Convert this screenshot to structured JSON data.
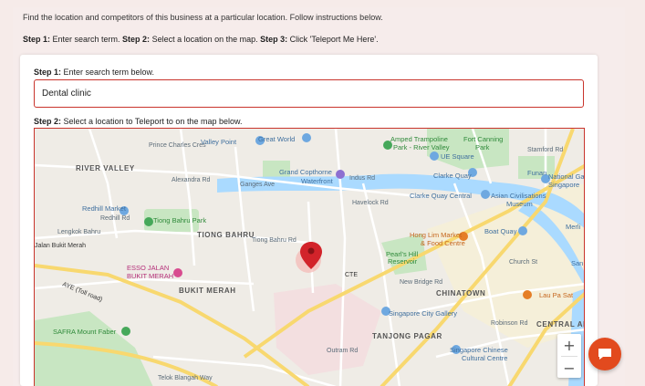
{
  "instructions": {
    "intro": "Find the location and competitors of this business at a particular location. Follow instructions below.",
    "step1_bold": "Step 1:",
    "step1_text": " Enter search term. ",
    "step2_bold": "Step 2:",
    "step2_text": " Select a location on the map. ",
    "step3_bold": "Step 3:",
    "step3_text": " Click 'Teleport Me Here'."
  },
  "form": {
    "step1_label_bold": "Step 1:",
    "step1_label_text": " Enter search term below.",
    "search_value": "Dental clinic",
    "step2_label_bold": "Step 2:",
    "step2_label_text": " Select a location to Teleport to on the map below."
  },
  "map": {
    "zoom_in": "+",
    "zoom_out": "−",
    "labels": {
      "prince_charles": "Prince Charles Cres",
      "valley_point": "Valley Point",
      "great_world": "Great World",
      "amped": "Amped Trampoline",
      "amped2": "Park - River Valley",
      "fort_canning": "Fort Canning",
      "fort_canning2": "Park",
      "ue_square": "UE Square",
      "stamford": "Stamford Rd",
      "river_valley": "RIVER VALLEY",
      "alexandra": "Alexandra Rd",
      "indus": "Indus Rd",
      "copthorne": "Grand Copthorne",
      "copthorne2": "Waterfront",
      "ganges": "Ganges Ave",
      "clarke_quay": "Clarke Quay",
      "funan": "Funan",
      "national_gallery": "National Ga",
      "national_gallery2": "Singapore",
      "havelock": "Havelock Rd",
      "clarke_central": "Clarke Quay Central",
      "asian_civ": "Asian Civilisations",
      "asian_civ2": "Museum",
      "redhill_market": "Redhill Market",
      "redhill_rd": "Redhill Rd",
      "tiong_bahru_park": "Tiong Bahru Park",
      "tiong_bahru": "TIONG BAHRU",
      "lengkok": "Lengkok Bahru",
      "jalan_bukit_merah": "Jalan Bukit Merah",
      "tiong_bahru_rd": "Tiong Bahru Rd",
      "hong_lim": "Hong Lim Market",
      "hong_lim2": "& Food Centre",
      "boat_quay": "Boat Quay",
      "merlion": "Merli",
      "pearls_hill": "Pearl's Hill",
      "pearls_hill2": "Reservoir",
      "esso": "ESSO JALAN",
      "esso2": "BUKIT MERAH",
      "bukit_merah": "BUKIT MERAH",
      "cte": "CTE",
      "ayes": "AYE (Toll road)",
      "new_bridge": "New Bridge Rd",
      "chinatown": "CHINATOWN",
      "lau_pa_sat": "Lau Pa Sat",
      "central_area": "CENTRAL AR",
      "singapore_city_gallery": "Singapore City Gallery",
      "safra": "SAFRA Mount Faber",
      "tanjong_pagar": "TANJONG PAGAR",
      "chinese_cultural": "Singapore Chinese",
      "chinese_cultural2": "Cultural Centre",
      "bukit_merah_view": "Telok Blangah Way",
      "outram": "Outram Rd",
      "robinson": "Robinson Rd",
      "church": "Church St",
      "san": "San"
    }
  },
  "colors": {
    "accent": "#c9342c",
    "chat": "#e24a1e",
    "park": "#c8e6c2",
    "water": "#aadaff",
    "road": "#ffffff",
    "highway": "#f8d86f"
  }
}
